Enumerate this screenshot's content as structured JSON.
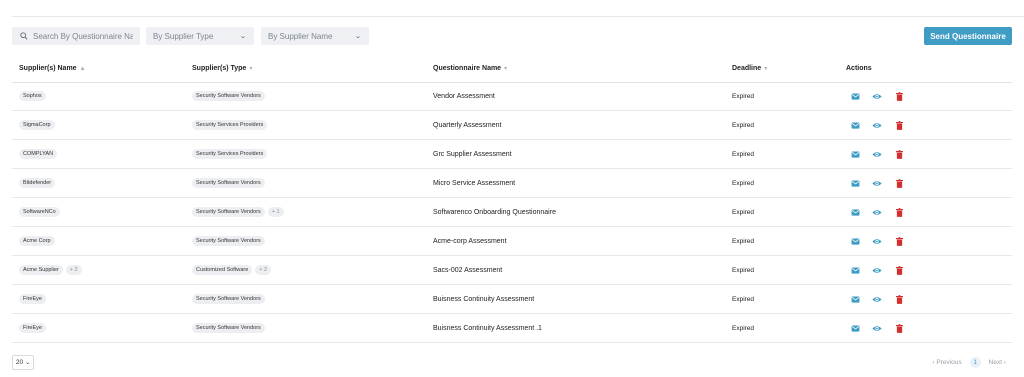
{
  "search": {
    "placeholder": "Search By Questionnaire Nam"
  },
  "filters": {
    "supplier_type": "By Supplier Type",
    "supplier_name": "By Supplier Name"
  },
  "send_button": "Send Questionnaire",
  "columns": {
    "supplier": "Supplier(s) Name",
    "type": "Supplier(s) Type",
    "questionnaire": "Questionnaire Name",
    "deadline": "Deadline",
    "actions": "Actions"
  },
  "rows": [
    {
      "supplier": "Sophos",
      "supplier_extra": "",
      "type": "Security Software Vendors",
      "type_extra": "",
      "questionnaire": "Vendor Assessment",
      "deadline": "Expired"
    },
    {
      "supplier": "SigmaCorp",
      "supplier_extra": "",
      "type": "Security Services Providers",
      "type_extra": "",
      "questionnaire": "Quarterly Assessment",
      "deadline": "Expired"
    },
    {
      "supplier": "COMPLYAN",
      "supplier_extra": "",
      "type": "Security Services Providers",
      "type_extra": "",
      "questionnaire": "Grc Supplier Assessment",
      "deadline": "Expired"
    },
    {
      "supplier": "Bitdefender",
      "supplier_extra": "",
      "type": "Security Software Vendors",
      "type_extra": "",
      "questionnaire": "Micro Service Assessment",
      "deadline": "Expired"
    },
    {
      "supplier": "SoftwareNCo",
      "supplier_extra": "",
      "type": "Security Software Vendors",
      "type_extra": "+ 1",
      "questionnaire": "Softwarenco Onboarding Questionnaire",
      "deadline": "Expired"
    },
    {
      "supplier": "Acme Corp",
      "supplier_extra": "",
      "type": "Security Software Vendors",
      "type_extra": "",
      "questionnaire": "Acme-corp Assessment",
      "deadline": "Expired"
    },
    {
      "supplier": "Acme Supplier",
      "supplier_extra": "+ 2",
      "type": "Customized Software",
      "type_extra": "+ 2",
      "questionnaire": "Sacs-002 Assessment",
      "deadline": "Expired"
    },
    {
      "supplier": "FireEye",
      "supplier_extra": "",
      "type": "Security Software Vendors",
      "type_extra": "",
      "questionnaire": "Buisness Continuity Assessment",
      "deadline": "Expired"
    },
    {
      "supplier": "FireEye",
      "supplier_extra": "",
      "type": "Security Software Vendors",
      "type_extra": "",
      "questionnaire": "Buisness Continuity Assessment .1",
      "deadline": "Expired"
    }
  ],
  "icons": {
    "mail": "mail-icon",
    "view": "eye-icon",
    "delete": "trash-icon"
  },
  "colors": {
    "accent": "#3f9cc4",
    "delete": "#d32f2f"
  },
  "footer": {
    "page_size": "20",
    "previous": "Previous",
    "current_page": "1",
    "next": "Next"
  }
}
